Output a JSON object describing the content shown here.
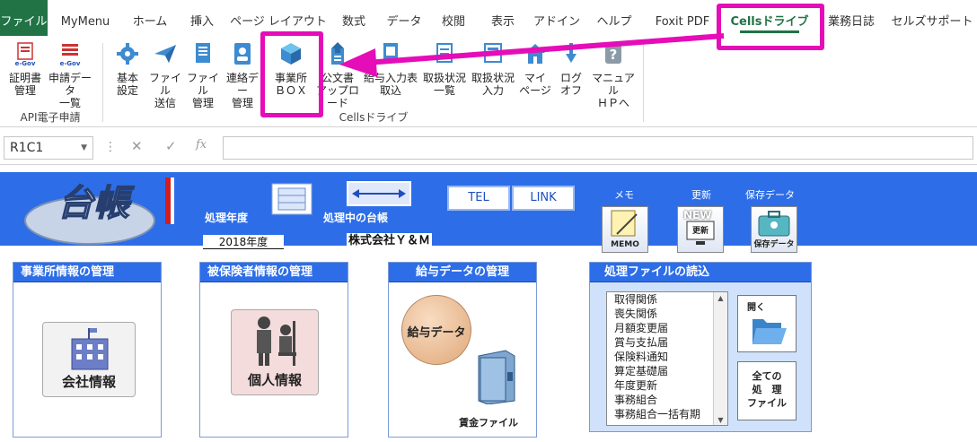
{
  "tabs": [
    "ファイル",
    "MyMenu",
    "ホーム",
    "挿入",
    "ページ レイアウト",
    "数式",
    "データ",
    "校閲",
    "表示",
    "アドイン",
    "ヘルプ",
    "Foxit PDF",
    "Cellsドライブ",
    "業務日誌",
    "セルズサポート"
  ],
  "active_tab": "Cellsドライブ",
  "ribbon": {
    "api_group": {
      "label": "API電子申請",
      "buttons": [
        {
          "l1": "証明書",
          "l2": "管理",
          "icon": "egov-cert-icon"
        },
        {
          "l1": "申請データ",
          "l2": "一覧",
          "icon": "egov-list-icon"
        }
      ]
    },
    "cells_group": {
      "label": "Cellsドライブ",
      "buttons": [
        {
          "l1": "基本",
          "l2": "設定",
          "icon": "gear-icon"
        },
        {
          "l1": "ファイル",
          "l2": "送信",
          "icon": "paper-plane-icon"
        },
        {
          "l1": "ファイル",
          "l2": "管理",
          "icon": "file-manage-icon"
        },
        {
          "l1": "連絡デー",
          "l2": "管理",
          "icon": "contact-icon"
        },
        {
          "l1": "事業所",
          "l2": "ＢＯＸ",
          "icon": "box-icon"
        },
        {
          "l1": "公文書",
          "l2": "アップロード",
          "icon": "upload-icon"
        },
        {
          "l1": "給与入力表",
          "l2": "取込",
          "icon": "import-icon"
        },
        {
          "l1": "取扱状況",
          "l2": "一覧",
          "icon": "status-list-icon"
        },
        {
          "l1": "取扱状況",
          "l2": "入力",
          "icon": "status-input-icon"
        },
        {
          "l1": "マイ",
          "l2": "ページ",
          "icon": "home-icon"
        },
        {
          "l1": "ログ",
          "l2": "オフ",
          "icon": "logoff-icon"
        },
        {
          "l1": "マニュアル",
          "l2": "ＨＰへ",
          "icon": "help-icon"
        }
      ]
    }
  },
  "formula_bar": {
    "name_box": "R1C1",
    "fx": "fx",
    "cancel": "✕",
    "enter": "✓"
  },
  "sheet": {
    "logo_text": "台帳",
    "year_label": "処理年度",
    "year_value": "2018年度",
    "ledger_label": "処理中の台帳",
    "ledger_value": "株式会社Ｙ＆Ｍ",
    "tel": "TEL",
    "link": "LINK",
    "memo_label": "メモ",
    "memo_btn": "MEMO",
    "update_label": "更新",
    "update_btn": "更新",
    "update_badge": "NEW",
    "save_label": "保存データ",
    "save_btn": "保存データ",
    "panel1": {
      "title": "事業所情報の管理",
      "button": "会社情報"
    },
    "panel2": {
      "title": "被保険者情報の管理",
      "button": "個人情報"
    },
    "panel3": {
      "title": "給与データの管理",
      "button": "給与データ",
      "ledger": "賃金ファイル"
    },
    "panel4": {
      "title": "処理ファイルの読込",
      "files": [
        "取得関係",
        "喪失関係",
        "月額変更届",
        "賞与支払届",
        "保険料通知",
        "算定基礎届",
        "年度更新",
        "事務組合",
        "事務組合一括有期"
      ],
      "open_btn": "開く",
      "all_btn_l1": "全ての",
      "all_btn_l2": "処　理",
      "all_btn_l3": "ファイル"
    }
  },
  "colors": {
    "accent": "#217346",
    "banner": "#2d6ee8",
    "highlight": "#e50db8"
  }
}
